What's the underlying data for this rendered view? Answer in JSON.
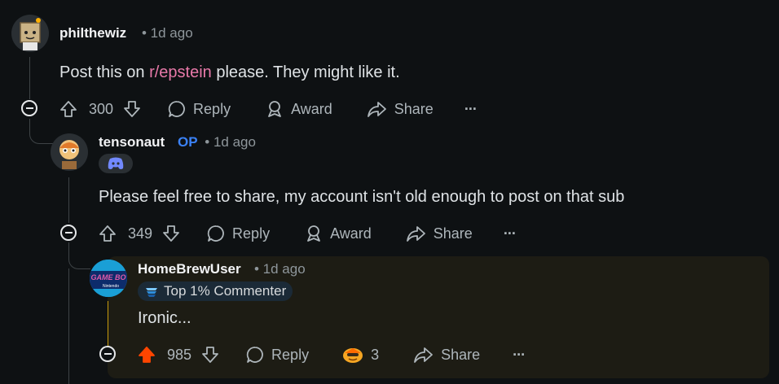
{
  "comments": [
    {
      "author": "philthewiz",
      "time": "• 1d ago",
      "body_pre": "Post this on ",
      "body_link": "r/epstein",
      "body_post": " please. They might like it.",
      "score": "300",
      "reply_label": "Reply",
      "award_label": "Award",
      "share_label": "Share",
      "more_label": "···"
    },
    {
      "author": "tensonaut",
      "op_label": "OP",
      "time": "• 1d ago",
      "badge_icon": "discord-icon",
      "body": "Please feel free to share, my account isn't old enough to post on that sub",
      "score": "349",
      "reply_label": "Reply",
      "award_label": "Award",
      "share_label": "Share",
      "more_label": "···"
    },
    {
      "author": "HomeBrewUser",
      "time": "• 1d ago",
      "flair": "Top 1% Commenter",
      "avatar_text_top": "GAME BO",
      "avatar_text_bottom": "Nintendo",
      "body": "Ironic...",
      "score": "985",
      "reply_label": "Reply",
      "award_count": "3",
      "share_label": "Share",
      "more_label": "···"
    }
  ],
  "colors": {
    "background": "#0e1113",
    "upvoted": "#ff4500",
    "op": "#3b82f6",
    "sub_link": "#e879a9"
  }
}
